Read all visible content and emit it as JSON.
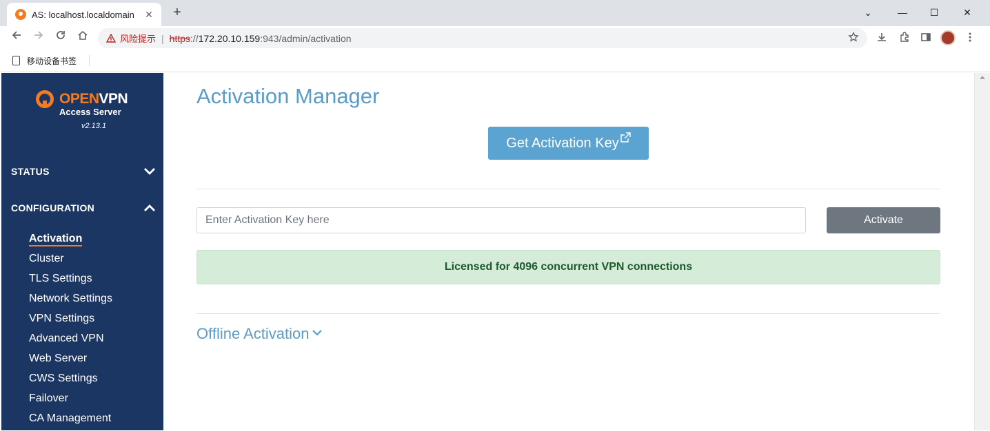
{
  "browser": {
    "tab_title": "AS: localhost.localdomain",
    "tab_close": "✕",
    "new_tab": "+",
    "minimize": "⌄",
    "restore": "—",
    "maximize": "☐",
    "close": "✕",
    "security_warning": "风险提示",
    "url_scheme": "https",
    "url_sep": "://",
    "url_host": "172.20.10.159",
    "url_rest": ":943/admin/activation",
    "bookmark_label": "移动设备书签"
  },
  "sidebar": {
    "brand_open": "OPEN",
    "brand_vpn": "VPN",
    "brand_sub": "Access Server",
    "version": "v2.13.1",
    "sections": [
      {
        "label": "STATUS",
        "expanded": false
      },
      {
        "label": "CONFIGURATION",
        "expanded": true
      }
    ],
    "items": [
      {
        "label": "Activation",
        "active": true
      },
      {
        "label": "Cluster"
      },
      {
        "label": "TLS Settings"
      },
      {
        "label": "Network Settings"
      },
      {
        "label": "VPN Settings"
      },
      {
        "label": "Advanced VPN"
      },
      {
        "label": "Web Server"
      },
      {
        "label": "CWS Settings"
      },
      {
        "label": "Failover"
      },
      {
        "label": "CA Management"
      }
    ]
  },
  "main": {
    "title": "Activation Manager",
    "get_key_label": "Get Activation Key",
    "key_placeholder": "Enter Activation Key here",
    "activate_label": "Activate",
    "license_text": "Licensed for 4096 concurrent VPN connections",
    "offline_label": "Offline Activation"
  },
  "colors": {
    "sidebar_bg": "#1c3664",
    "brand_orange": "#f47b20",
    "title_blue": "#5b9cc6",
    "button_blue": "#5ba3d0",
    "button_gray": "#6e7680",
    "success_bg": "#d5ecd9"
  }
}
